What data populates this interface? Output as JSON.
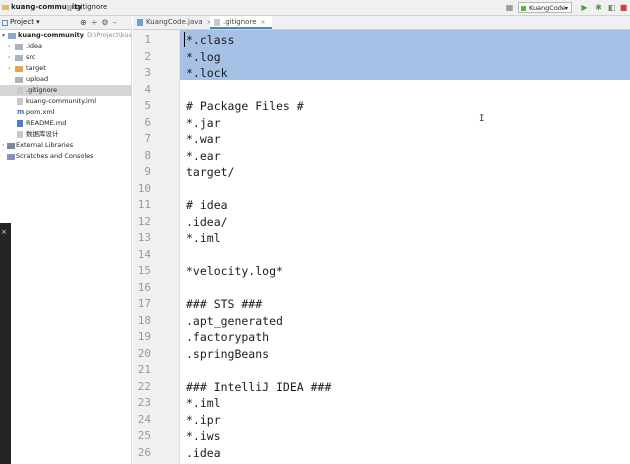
{
  "breadcrumb": {
    "project": "kuang-community",
    "file": ".gitignore"
  },
  "toolbar": {
    "run_config": "KuangCode"
  },
  "project_panel": {
    "title": "Project"
  },
  "tabs": [
    {
      "label": "KuangCode.java",
      "active": false
    },
    {
      "label": ".gitignore",
      "active": true
    }
  ],
  "tree": [
    {
      "name": "kuang-community",
      "hint": "D:\\Project\\kuang-c",
      "icon": "folder-icon",
      "arrow": "▾",
      "bold": true
    },
    {
      "name": ".idea",
      "icon": "folder-icon",
      "arrow": "›"
    },
    {
      "name": "src",
      "icon": "folder-icon",
      "arrow": "›"
    },
    {
      "name": "target",
      "icon": "folder-orange-icon",
      "arrow": "›"
    },
    {
      "name": "upload",
      "icon": "folder-icon",
      "arrow": ""
    },
    {
      "name": ".gitignore",
      "icon": "file-icon",
      "arrow": "",
      "selected": true
    },
    {
      "name": "kuang-community.iml",
      "icon": "file-icon",
      "arrow": ""
    },
    {
      "name": "pom.xml",
      "icon": "maven-icon",
      "arrow": ""
    },
    {
      "name": "README.md",
      "icon": "markdown-icon",
      "arrow": ""
    },
    {
      "name": "数据库设计",
      "icon": "file-icon",
      "arrow": ""
    },
    {
      "name": "External Libraries",
      "icon": "library-icon",
      "arrow": "›"
    },
    {
      "name": "Scratches and Consoles",
      "icon": "scratches-icon",
      "arrow": ""
    }
  ],
  "editor": {
    "lines": [
      "*.class",
      "*.log",
      "*.lock",
      "",
      "# Package Files #",
      "*.jar",
      "*.war",
      "*.ear",
      "target/",
      "",
      "# idea",
      ".idea/",
      "*.iml",
      "",
      "*velocity.log*",
      "",
      "### STS ###",
      ".apt_generated",
      ".factorypath",
      ".springBeans",
      "",
      "### IntelliJ IDEA ###",
      "*.iml",
      "*.ipr",
      "*.iws",
      ".idea"
    ],
    "line_numbers": [
      "1",
      "2",
      "3",
      "4",
      "5",
      "6",
      "7",
      "8",
      "9",
      "10",
      "11",
      "12",
      "13",
      "14",
      "15",
      "16",
      "17",
      "18",
      "19",
      "20",
      "21",
      "22",
      "23",
      "24",
      "25",
      "26"
    ],
    "selected_lines": [
      1,
      2,
      3
    ]
  },
  "colors": {
    "selection": "#a6c0e6",
    "gutter": "#f0f0f0",
    "tab_underline": "#4a88c7",
    "run_green": "#62b543"
  }
}
